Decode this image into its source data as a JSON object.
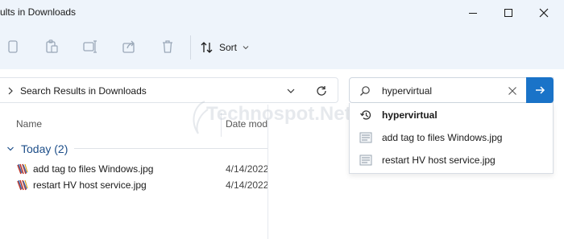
{
  "window": {
    "title": "ults in Downloads"
  },
  "toolbar": {
    "icons": [
      "copy-icon",
      "paste-icon",
      "rename-icon",
      "share-icon",
      "delete-icon"
    ],
    "sort_label": "Sort"
  },
  "address_bar": {
    "path": "Search Results in Downloads"
  },
  "columns": {
    "name": "Name",
    "date": "Date modified"
  },
  "group": {
    "label": "Today (2)"
  },
  "files": [
    {
      "name": "add tag to files Windows.jpg",
      "date": "4/14/2022"
    },
    {
      "name": "restart HV host service.jpg",
      "date": "4/14/2022"
    }
  ],
  "search": {
    "value": "hypervirtual",
    "suggestions": [
      {
        "icon": "history-icon",
        "text": "hypervirtual"
      },
      {
        "icon": "image-file-icon",
        "text": "add tag to files Windows.jpg"
      },
      {
        "icon": "image-file-icon",
        "text": "restart HV host service.jpg"
      }
    ]
  },
  "watermark": {
    "text": "Technospot.Net"
  },
  "colors": {
    "accent": "#1a73c8",
    "chrome_bg": "#eef4fb",
    "group_text": "#1d4e89"
  }
}
